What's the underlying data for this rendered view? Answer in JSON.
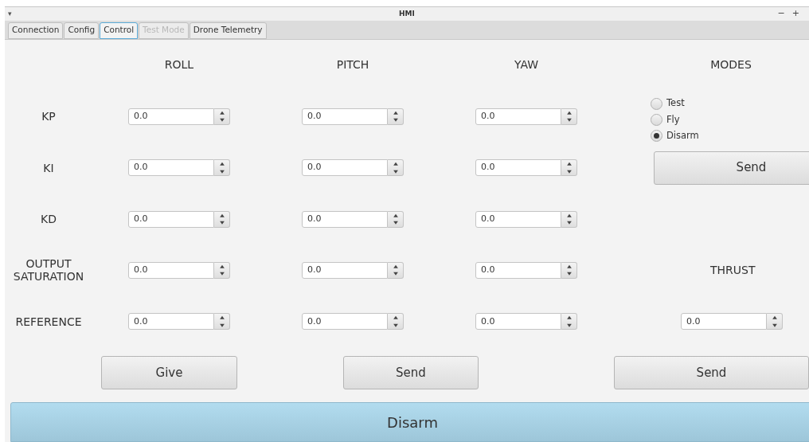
{
  "window": {
    "title": "HMI",
    "menu_glyph": "▾",
    "controls": [
      "−",
      "+"
    ]
  },
  "tabs": [
    {
      "label": "Connection",
      "selected": false,
      "disabled": false
    },
    {
      "label": "Config",
      "selected": false,
      "disabled": false
    },
    {
      "label": "Control",
      "selected": true,
      "disabled": false
    },
    {
      "label": "Test Mode",
      "selected": false,
      "disabled": true
    },
    {
      "label": "Drone Telemetry",
      "selected": false,
      "disabled": false
    }
  ],
  "columns": [
    "ROLL",
    "PITCH",
    "YAW"
  ],
  "rows": [
    {
      "label": "KP",
      "values": [
        "0.0",
        "0.0",
        "0.0"
      ]
    },
    {
      "label": "KI",
      "values": [
        "0.0",
        "0.0",
        "0.0"
      ]
    },
    {
      "label": "KD",
      "values": [
        "0.0",
        "0.0",
        "0.0"
      ]
    },
    {
      "label": "OUTPUT SATURATION",
      "values": [
        "0.0",
        "0.0",
        "0.0"
      ]
    },
    {
      "label": "REFERENCE",
      "values": [
        "0.0",
        "0.0",
        "0.0"
      ]
    }
  ],
  "modes": {
    "title": "MODES",
    "options": [
      {
        "label": "Test",
        "selected": false
      },
      {
        "label": "Fly",
        "selected": false
      },
      {
        "label": "Disarm",
        "selected": true
      }
    ],
    "button": "Send"
  },
  "thrust": {
    "title": "THRUST",
    "value": "0.0"
  },
  "buttons": [
    "Give",
    "Send",
    "Send"
  ],
  "main_button": "Disarm"
}
